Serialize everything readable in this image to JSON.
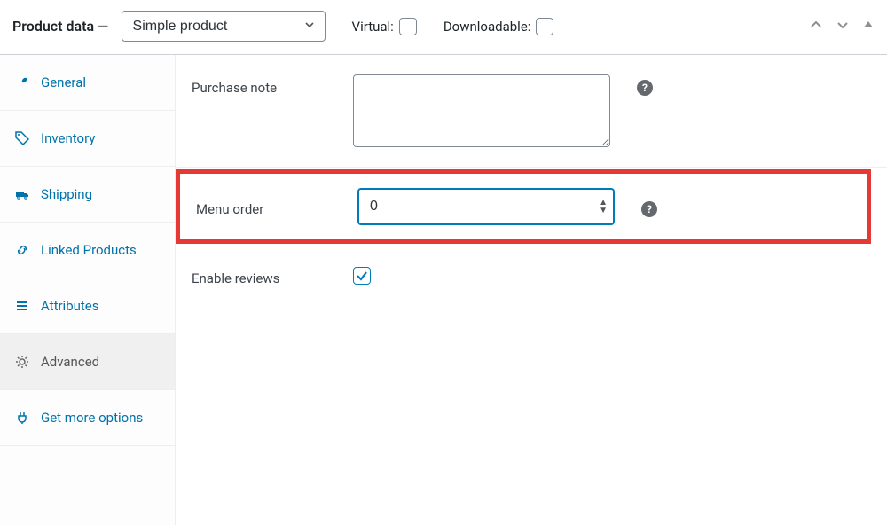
{
  "header": {
    "title": "Product data",
    "dash": "—",
    "product_type": "Simple product",
    "virtual_label": "Virtual:",
    "downloadable_label": "Downloadable:",
    "virtual_checked": false,
    "downloadable_checked": false
  },
  "sidebar": {
    "items": [
      {
        "id": "general",
        "label": "General",
        "icon": "wrench-icon"
      },
      {
        "id": "inventory",
        "label": "Inventory",
        "icon": "tag-icon"
      },
      {
        "id": "shipping",
        "label": "Shipping",
        "icon": "truck-icon"
      },
      {
        "id": "linked",
        "label": "Linked Products",
        "icon": "link-icon"
      },
      {
        "id": "attributes",
        "label": "Attributes",
        "icon": "list-icon"
      },
      {
        "id": "advanced",
        "label": "Advanced",
        "icon": "gear-icon",
        "active": true
      },
      {
        "id": "getmore",
        "label": "Get more options",
        "icon": "plug-icon"
      }
    ]
  },
  "fields": {
    "purchase_note_label": "Purchase note",
    "purchase_note_value": "",
    "menu_order_label": "Menu order",
    "menu_order_value": "0",
    "enable_reviews_label": "Enable reviews",
    "enable_reviews_checked": true,
    "help_glyph": "?"
  }
}
